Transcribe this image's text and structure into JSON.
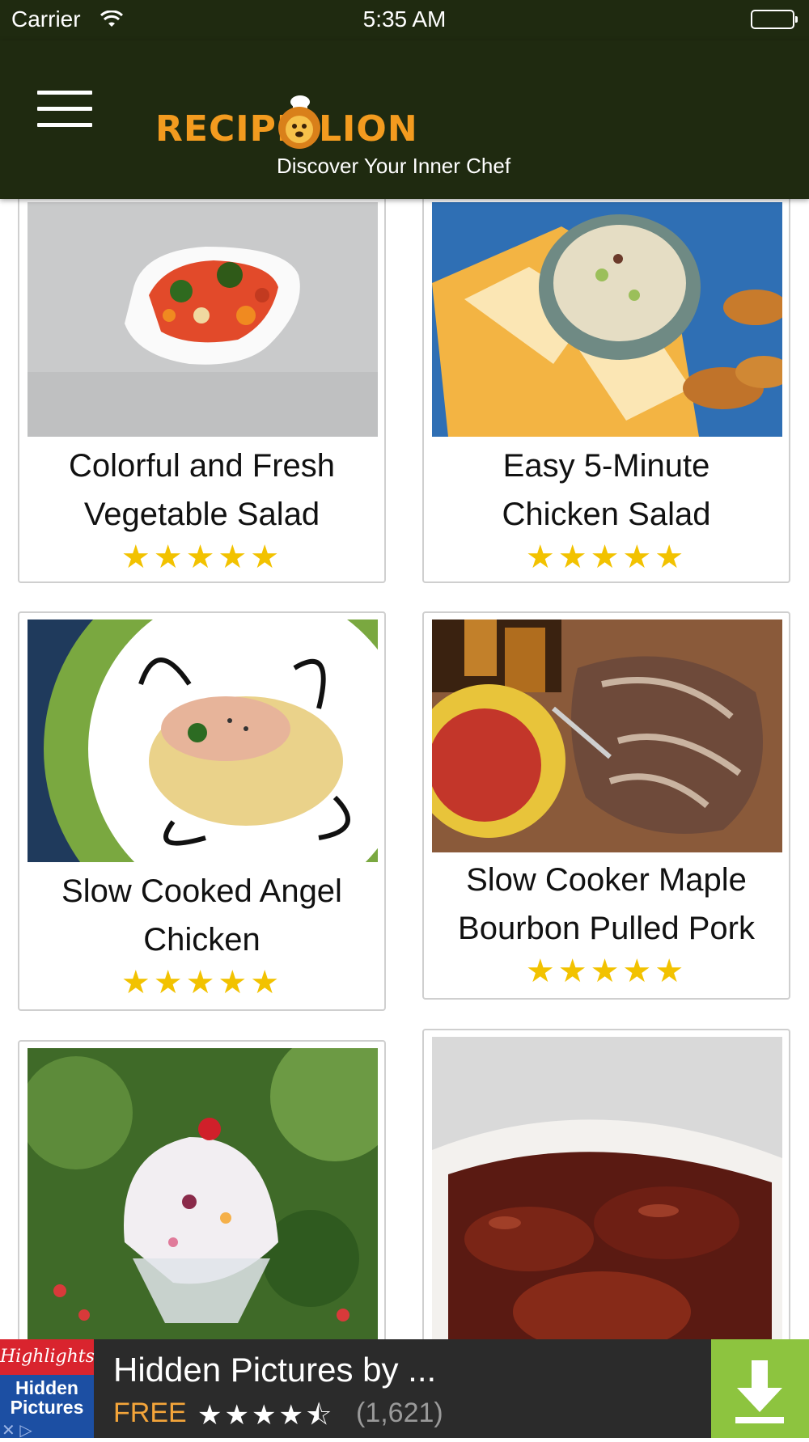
{
  "status_bar": {
    "carrier": "Carrier",
    "time": "5:35 AM"
  },
  "header": {
    "logo_word_1": "RECIPE",
    "logo_word_2": "LION",
    "tagline": "Discover Your Inner Chef",
    "menu_icon": "hamburger-icon"
  },
  "recipes": [
    {
      "title_line1": "Colorful and Fresh",
      "title_line2": "Vegetable Salad",
      "stars": "★★★★★",
      "rating": 5
    },
    {
      "title_line1": "Easy 5-Minute",
      "title_line2": "Chicken Salad",
      "stars": "★★★★★",
      "rating": 5
    },
    {
      "title_line1": "Slow Cooked Angel",
      "title_line2": "Chicken",
      "stars": "★★★★★",
      "rating": 5
    },
    {
      "title_line1": "Slow Cooker Maple",
      "title_line2": "Bourbon Pulled Pork",
      "stars": "★★★★★",
      "rating": 5
    },
    {
      "title_line1": "",
      "title_line2": "",
      "stars": "",
      "rating": null
    },
    {
      "title_line1": "",
      "title_line2": "",
      "stars": "",
      "rating": null
    }
  ],
  "ad": {
    "icon_brand": "Highlights",
    "icon_title_line1": "Hidden",
    "icon_title_line2": "Pictures",
    "title": "Hidden Pictures by ...",
    "price": "FREE",
    "stars": "★★★★⯪",
    "rating": 4.5,
    "review_count": "(1,621)",
    "download_icon": "download-icon",
    "close_label": "✕ ▷"
  },
  "colors": {
    "header_bg": "#1f2a10",
    "logo_orange": "#f39b1f",
    "star_yellow": "#f2c200",
    "ad_bg": "#2b2b2b",
    "ad_download_green": "#8dc43f"
  }
}
